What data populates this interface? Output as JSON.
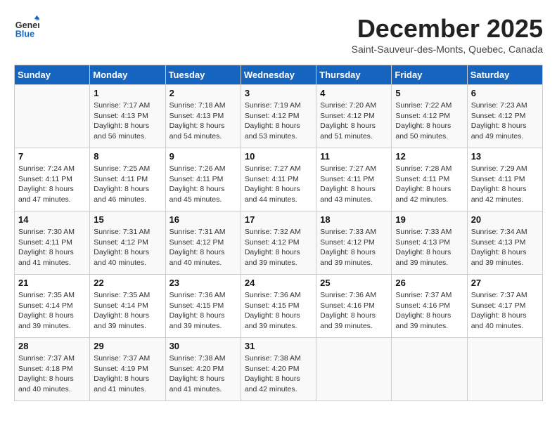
{
  "logo": {
    "line1": "General",
    "line2": "Blue"
  },
  "title": "December 2025",
  "subtitle": "Saint-Sauveur-des-Monts, Quebec, Canada",
  "weekdays": [
    "Sunday",
    "Monday",
    "Tuesday",
    "Wednesday",
    "Thursday",
    "Friday",
    "Saturday"
  ],
  "weeks": [
    [
      {
        "day": "",
        "sunrise": "",
        "sunset": "",
        "daylight": ""
      },
      {
        "day": "1",
        "sunrise": "Sunrise: 7:17 AM",
        "sunset": "Sunset: 4:13 PM",
        "daylight": "Daylight: 8 hours and 56 minutes."
      },
      {
        "day": "2",
        "sunrise": "Sunrise: 7:18 AM",
        "sunset": "Sunset: 4:13 PM",
        "daylight": "Daylight: 8 hours and 54 minutes."
      },
      {
        "day": "3",
        "sunrise": "Sunrise: 7:19 AM",
        "sunset": "Sunset: 4:12 PM",
        "daylight": "Daylight: 8 hours and 53 minutes."
      },
      {
        "day": "4",
        "sunrise": "Sunrise: 7:20 AM",
        "sunset": "Sunset: 4:12 PM",
        "daylight": "Daylight: 8 hours and 51 minutes."
      },
      {
        "day": "5",
        "sunrise": "Sunrise: 7:22 AM",
        "sunset": "Sunset: 4:12 PM",
        "daylight": "Daylight: 8 hours and 50 minutes."
      },
      {
        "day": "6",
        "sunrise": "Sunrise: 7:23 AM",
        "sunset": "Sunset: 4:12 PM",
        "daylight": "Daylight: 8 hours and 49 minutes."
      }
    ],
    [
      {
        "day": "7",
        "sunrise": "Sunrise: 7:24 AM",
        "sunset": "Sunset: 4:11 PM",
        "daylight": "Daylight: 8 hours and 47 minutes."
      },
      {
        "day": "8",
        "sunrise": "Sunrise: 7:25 AM",
        "sunset": "Sunset: 4:11 PM",
        "daylight": "Daylight: 8 hours and 46 minutes."
      },
      {
        "day": "9",
        "sunrise": "Sunrise: 7:26 AM",
        "sunset": "Sunset: 4:11 PM",
        "daylight": "Daylight: 8 hours and 45 minutes."
      },
      {
        "day": "10",
        "sunrise": "Sunrise: 7:27 AM",
        "sunset": "Sunset: 4:11 PM",
        "daylight": "Daylight: 8 hours and 44 minutes."
      },
      {
        "day": "11",
        "sunrise": "Sunrise: 7:27 AM",
        "sunset": "Sunset: 4:11 PM",
        "daylight": "Daylight: 8 hours and 43 minutes."
      },
      {
        "day": "12",
        "sunrise": "Sunrise: 7:28 AM",
        "sunset": "Sunset: 4:11 PM",
        "daylight": "Daylight: 8 hours and 42 minutes."
      },
      {
        "day": "13",
        "sunrise": "Sunrise: 7:29 AM",
        "sunset": "Sunset: 4:11 PM",
        "daylight": "Daylight: 8 hours and 42 minutes."
      }
    ],
    [
      {
        "day": "14",
        "sunrise": "Sunrise: 7:30 AM",
        "sunset": "Sunset: 4:11 PM",
        "daylight": "Daylight: 8 hours and 41 minutes."
      },
      {
        "day": "15",
        "sunrise": "Sunrise: 7:31 AM",
        "sunset": "Sunset: 4:12 PM",
        "daylight": "Daylight: 8 hours and 40 minutes."
      },
      {
        "day": "16",
        "sunrise": "Sunrise: 7:31 AM",
        "sunset": "Sunset: 4:12 PM",
        "daylight": "Daylight: 8 hours and 40 minutes."
      },
      {
        "day": "17",
        "sunrise": "Sunrise: 7:32 AM",
        "sunset": "Sunset: 4:12 PM",
        "daylight": "Daylight: 8 hours and 39 minutes."
      },
      {
        "day": "18",
        "sunrise": "Sunrise: 7:33 AM",
        "sunset": "Sunset: 4:12 PM",
        "daylight": "Daylight: 8 hours and 39 minutes."
      },
      {
        "day": "19",
        "sunrise": "Sunrise: 7:33 AM",
        "sunset": "Sunset: 4:13 PM",
        "daylight": "Daylight: 8 hours and 39 minutes."
      },
      {
        "day": "20",
        "sunrise": "Sunrise: 7:34 AM",
        "sunset": "Sunset: 4:13 PM",
        "daylight": "Daylight: 8 hours and 39 minutes."
      }
    ],
    [
      {
        "day": "21",
        "sunrise": "Sunrise: 7:35 AM",
        "sunset": "Sunset: 4:14 PM",
        "daylight": "Daylight: 8 hours and 39 minutes."
      },
      {
        "day": "22",
        "sunrise": "Sunrise: 7:35 AM",
        "sunset": "Sunset: 4:14 PM",
        "daylight": "Daylight: 8 hours and 39 minutes."
      },
      {
        "day": "23",
        "sunrise": "Sunrise: 7:36 AM",
        "sunset": "Sunset: 4:15 PM",
        "daylight": "Daylight: 8 hours and 39 minutes."
      },
      {
        "day": "24",
        "sunrise": "Sunrise: 7:36 AM",
        "sunset": "Sunset: 4:15 PM",
        "daylight": "Daylight: 8 hours and 39 minutes."
      },
      {
        "day": "25",
        "sunrise": "Sunrise: 7:36 AM",
        "sunset": "Sunset: 4:16 PM",
        "daylight": "Daylight: 8 hours and 39 minutes."
      },
      {
        "day": "26",
        "sunrise": "Sunrise: 7:37 AM",
        "sunset": "Sunset: 4:16 PM",
        "daylight": "Daylight: 8 hours and 39 minutes."
      },
      {
        "day": "27",
        "sunrise": "Sunrise: 7:37 AM",
        "sunset": "Sunset: 4:17 PM",
        "daylight": "Daylight: 8 hours and 40 minutes."
      }
    ],
    [
      {
        "day": "28",
        "sunrise": "Sunrise: 7:37 AM",
        "sunset": "Sunset: 4:18 PM",
        "daylight": "Daylight: 8 hours and 40 minutes."
      },
      {
        "day": "29",
        "sunrise": "Sunrise: 7:37 AM",
        "sunset": "Sunset: 4:19 PM",
        "daylight": "Daylight: 8 hours and 41 minutes."
      },
      {
        "day": "30",
        "sunrise": "Sunrise: 7:38 AM",
        "sunset": "Sunset: 4:20 PM",
        "daylight": "Daylight: 8 hours and 41 minutes."
      },
      {
        "day": "31",
        "sunrise": "Sunrise: 7:38 AM",
        "sunset": "Sunset: 4:20 PM",
        "daylight": "Daylight: 8 hours and 42 minutes."
      },
      {
        "day": "",
        "sunrise": "",
        "sunset": "",
        "daylight": ""
      },
      {
        "day": "",
        "sunrise": "",
        "sunset": "",
        "daylight": ""
      },
      {
        "day": "",
        "sunrise": "",
        "sunset": "",
        "daylight": ""
      }
    ]
  ]
}
